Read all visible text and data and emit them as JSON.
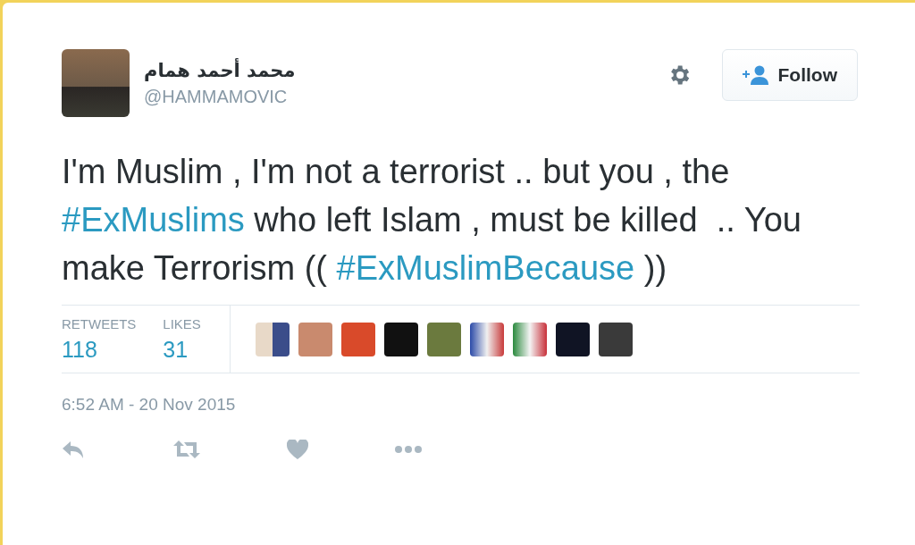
{
  "author": {
    "name": "محمد أحمد همام",
    "handle": "@HAMMAMOVIC"
  },
  "follow_button": {
    "label": "Follow"
  },
  "tweet": {
    "segments": [
      {
        "kind": "text",
        "text": "I'm Muslim , I'm not a terrorist .. but you , the "
      },
      {
        "kind": "hashtag",
        "text": "#ExMuslims"
      },
      {
        "kind": "text",
        "text": " who left Islam , must be killed  .. You make Terrorism (( "
      },
      {
        "kind": "hashtag",
        "text": "#ExMuslimBecause"
      },
      {
        "kind": "text",
        "text": " ))"
      }
    ]
  },
  "stats": [
    {
      "label": "RETWEETS",
      "value": "118"
    },
    {
      "label": "LIKES",
      "value": "31"
    }
  ],
  "timestamp": "6:52 AM - 20 Nov 2015"
}
